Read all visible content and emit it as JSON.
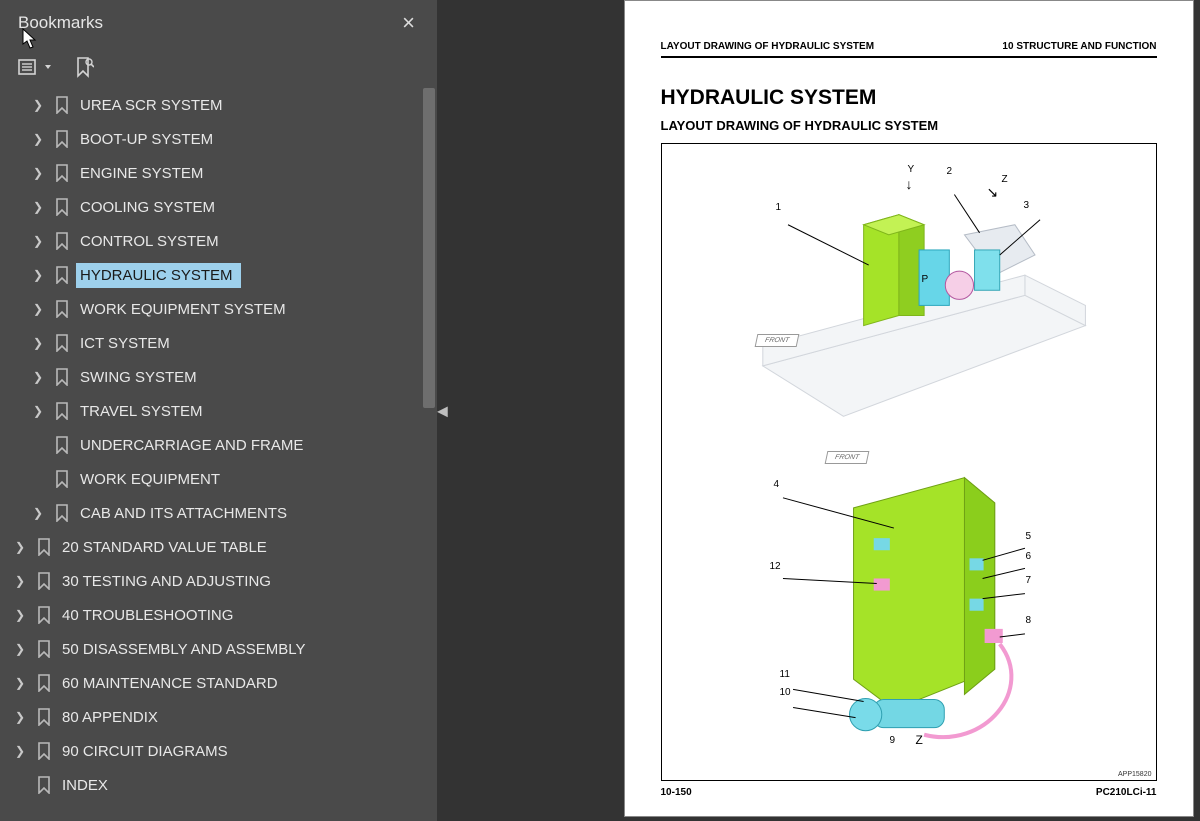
{
  "panel": {
    "title": "Bookmarks"
  },
  "tree": {
    "items": [
      {
        "level": 2,
        "label": "UREA SCR SYSTEM",
        "expandable": true
      },
      {
        "level": 2,
        "label": "BOOT-UP SYSTEM",
        "expandable": true
      },
      {
        "level": 2,
        "label": "ENGINE SYSTEM",
        "expandable": true
      },
      {
        "level": 2,
        "label": "COOLING SYSTEM",
        "expandable": true
      },
      {
        "level": 2,
        "label": "CONTROL SYSTEM",
        "expandable": true
      },
      {
        "level": 2,
        "label": "HYDRAULIC SYSTEM",
        "expandable": true,
        "active": true
      },
      {
        "level": 2,
        "label": "WORK EQUIPMENT SYSTEM",
        "expandable": true
      },
      {
        "level": 2,
        "label": "ICT SYSTEM",
        "expandable": true
      },
      {
        "level": 2,
        "label": "SWING SYSTEM",
        "expandable": true
      },
      {
        "level": 2,
        "label": "TRAVEL SYSTEM",
        "expandable": true
      },
      {
        "level": 2,
        "label": "UNDERCARRIAGE AND FRAME",
        "expandable": false
      },
      {
        "level": 2,
        "label": "WORK EQUIPMENT",
        "expandable": false
      },
      {
        "level": 2,
        "label": "CAB AND ITS ATTACHMENTS",
        "expandable": true
      },
      {
        "level": 1,
        "label": "20 STANDARD VALUE TABLE",
        "expandable": true
      },
      {
        "level": 1,
        "label": "30 TESTING AND ADJUSTING",
        "expandable": true
      },
      {
        "level": 1,
        "label": "40 TROUBLESHOOTING",
        "expandable": true
      },
      {
        "level": 1,
        "label": "50 DISASSEMBLY AND ASSEMBLY",
        "expandable": true
      },
      {
        "level": 1,
        "label": "60 MAINTENANCE STANDARD",
        "expandable": true
      },
      {
        "level": 1,
        "label": "80 APPENDIX",
        "expandable": true
      },
      {
        "level": 1,
        "label": "90 CIRCUIT DIAGRAMS",
        "expandable": true
      },
      {
        "level": 1,
        "label": "INDEX",
        "expandable": false
      }
    ]
  },
  "doc": {
    "header_left": "LAYOUT DRAWING OF HYDRAULIC SYSTEM",
    "header_right": "10 STRUCTURE AND FUNCTION",
    "h1": "HYDRAULIC SYSTEM",
    "h2": "LAYOUT DRAWING OF HYDRAULIC SYSTEM",
    "footer_left": "10-150",
    "footer_right": "PC210LCi-11",
    "front_label": "FRONT",
    "figure_id": "APP15820",
    "callouts_upper": {
      "c1": "1",
      "c2": "2",
      "c3": "3",
      "Y": "Y",
      "Z": "Z",
      "P": "P"
    },
    "callouts_lower": {
      "c4": "4",
      "c5": "5",
      "c6": "6",
      "c7": "7",
      "c8": "8",
      "c9": "9",
      "c10": "10",
      "c11": "11",
      "c12": "12",
      "Z": "Z"
    }
  }
}
